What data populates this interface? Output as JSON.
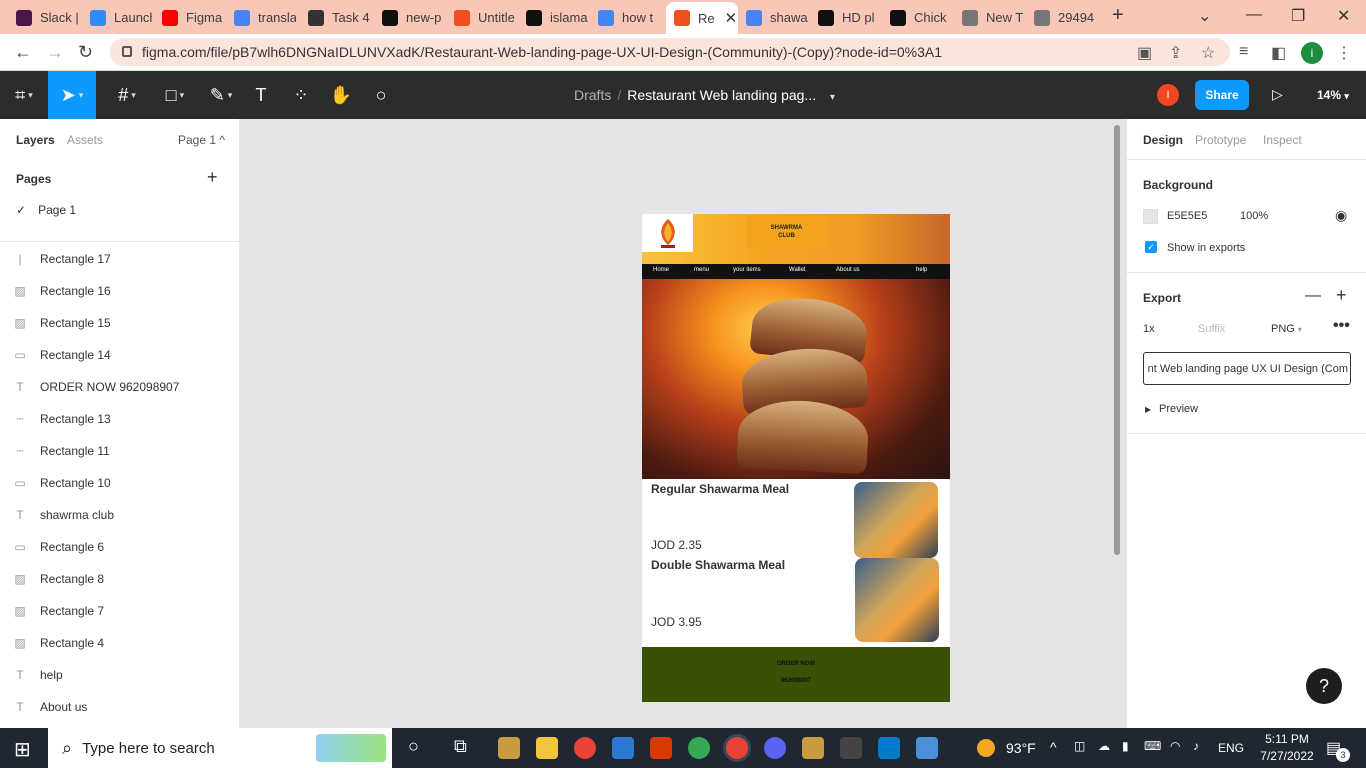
{
  "browser": {
    "tabs": [
      {
        "label": "Slack |",
        "icon": "slack-icon",
        "color": "#4a154b"
      },
      {
        "label": "Launch",
        "icon": "zoom-icon",
        "color": "#2d8cff"
      },
      {
        "label": "Figma",
        "icon": "youtube-icon",
        "color": "#ff0000"
      },
      {
        "label": "transla",
        "icon": "google-icon",
        "color": "#4285f4"
      },
      {
        "label": "Task 4",
        "icon": "contact-card-icon",
        "color": "#333333"
      },
      {
        "label": "new-p",
        "icon": "github-icon",
        "color": "#111111"
      },
      {
        "label": "Untitle",
        "icon": "figma-icon",
        "color": "#f24e1e"
      },
      {
        "label": "islama",
        "icon": "github-icon",
        "color": "#111111"
      },
      {
        "label": "how t",
        "icon": "google-icon",
        "color": "#4285f4"
      },
      {
        "label": "Re",
        "icon": "figma-icon",
        "color": "#f24e1e"
      },
      {
        "label": "shawa",
        "icon": "google-icon",
        "color": "#4285f4"
      },
      {
        "label": "HD pl",
        "icon": "hd-icon",
        "color": "#111111"
      },
      {
        "label": "Chick",
        "icon": "istock-icon",
        "color": "#111111"
      },
      {
        "label": "New T",
        "icon": "chrome-icon",
        "color": "#777777"
      },
      {
        "label": "29494",
        "icon": "globe-icon",
        "color": "#777777"
      }
    ],
    "url": "figma.com/file/pB7wlh6DNGNaIDLUNVXadK/Restaurant-Web-landing-page-UX-UI-Design-(Community)-(Copy)?node-id=0%3A1",
    "avatar_letter": "i"
  },
  "figma": {
    "breadcrumb_drafts": "Drafts",
    "breadcrumb_sep": "/",
    "file_title": "Restaurant Web landing pag...",
    "share_label": "Share",
    "user_initial": "I",
    "zoom": "14%"
  },
  "left_panel": {
    "tab_layers": "Layers",
    "tab_assets": "Assets",
    "page_select": "Page 1 ^",
    "pages_heading": "Pages",
    "current_page": "Page 1",
    "layers": [
      {
        "name": "Rectangle 17",
        "icon": "line"
      },
      {
        "name": "Rectangle 16",
        "icon": "image"
      },
      {
        "name": "Rectangle 15",
        "icon": "image"
      },
      {
        "name": "Rectangle 14",
        "icon": "rect"
      },
      {
        "name": "ORDER NOW 962098907",
        "icon": "text"
      },
      {
        "name": "Rectangle 13",
        "icon": "dash"
      },
      {
        "name": "Rectangle 11",
        "icon": "dash"
      },
      {
        "name": "Rectangle 10",
        "icon": "rect"
      },
      {
        "name": "shawrma club",
        "icon": "text"
      },
      {
        "name": "Rectangle 6",
        "icon": "rect"
      },
      {
        "name": "Rectangle 8",
        "icon": "image"
      },
      {
        "name": "Rectangle 7",
        "icon": "image"
      },
      {
        "name": "Rectangle 4",
        "icon": "image"
      },
      {
        "name": "help",
        "icon": "text"
      },
      {
        "name": "About us",
        "icon": "text"
      }
    ]
  },
  "design": {
    "brand_line1": "SHAWRMA",
    "brand_line2": "CLUB",
    "nav": [
      "Home",
      "menu",
      "your items",
      "Wallet",
      "About us",
      "help"
    ],
    "items": [
      {
        "name": "Regular Shawarma Meal",
        "price": "JOD 2.35"
      },
      {
        "name": "Double Shawarma Meal",
        "price": "JOD 3.95"
      }
    ],
    "order_label": "ORDER NOW",
    "order_phone": "962098907"
  },
  "right_panel": {
    "tab_design": "Design",
    "tab_prototype": "Prototype",
    "tab_inspect": "Inspect",
    "background_heading": "Background",
    "bg_hex": "E5E5E5",
    "bg_opacity": "100%",
    "show_in_exports": "Show in exports",
    "export_heading": "Export",
    "export_scale": "1x",
    "export_suffix_placeholder": "Suffix",
    "export_format": "PNG",
    "export_name": "nt Web landing page UX UI Design (Com",
    "preview_label": "Preview"
  },
  "taskbar": {
    "search_placeholder": "Type here to search",
    "weather": "93°F",
    "lang": "ENG",
    "time": "5:11 PM",
    "date": "7/27/2022",
    "notif_count": "3"
  }
}
